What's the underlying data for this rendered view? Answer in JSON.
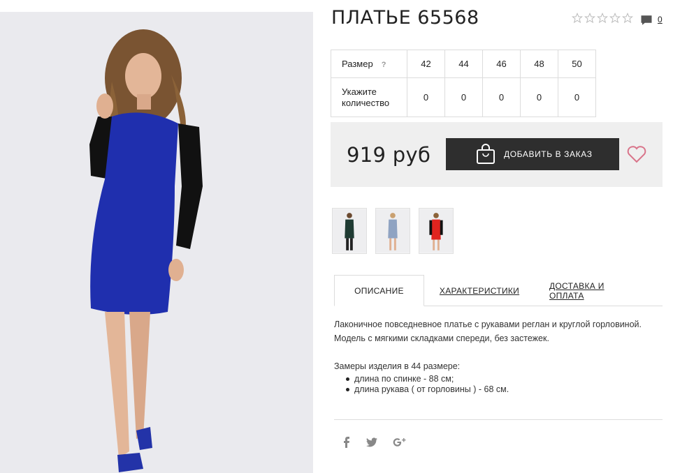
{
  "product": {
    "title": "ПЛАТЬЕ 65568",
    "comment_count": "0",
    "rating_stars": 5
  },
  "sizes": {
    "size_label": "Размер",
    "help": "?",
    "qty_label_line1": "Укажите",
    "qty_label_line2": "количество",
    "list": [
      "42",
      "44",
      "46",
      "48",
      "50"
    ],
    "quantities": [
      "0",
      "0",
      "0",
      "0",
      "0"
    ]
  },
  "price_box": {
    "price": "919 руб",
    "add_button": "ДОБАВИТЬ В ЗАКАЗ"
  },
  "thumbnails": [
    {
      "name": "green",
      "color": "#1f3b33"
    },
    {
      "name": "grey-blue",
      "color": "#8fa3c2"
    },
    {
      "name": "red",
      "color": "#e0241f"
    }
  ],
  "tabs": {
    "description": "ОПИСАНИЕ",
    "characteristics": "ХАРАКТЕРИСТИКИ",
    "delivery": "ДОСТАВКА И ОПЛАТА"
  },
  "description": {
    "line1": "Лаконичное повседневное платье с рукавами реглан и круглой горловиной.",
    "line2": "Модель с мягкими складками спереди, без застежек.",
    "measures_title": "Замеры изделия в 44 размере:",
    "measures": [
      "длина по спинке - 88 см;",
      "длина рукава ( от горловины ) - 68 см."
    ]
  },
  "colors": {
    "dress_main": "#1f2fae",
    "accent_heart": "#d9748a",
    "button_bg": "#2e2e2e",
    "price_box_bg": "#efefef"
  }
}
